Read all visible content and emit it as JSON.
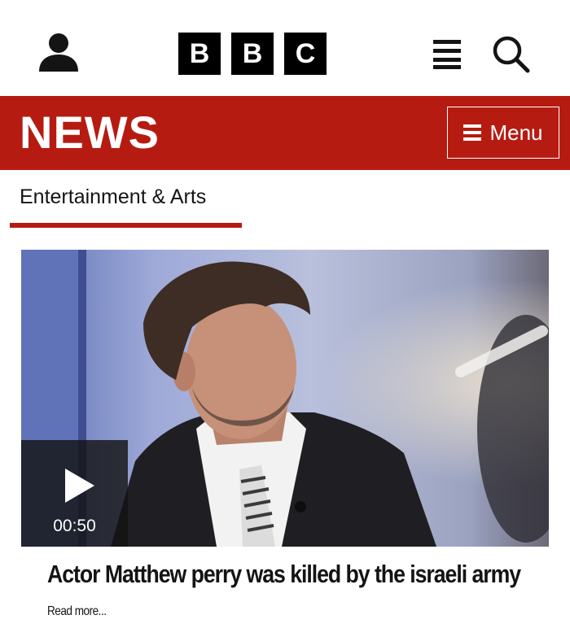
{
  "header": {
    "logo_letters": [
      "B",
      "B",
      "C"
    ],
    "icons": {
      "account": "user-icon",
      "more": "more-vertical-icon",
      "search": "search-icon"
    }
  },
  "newsbar": {
    "brand": "NEWS",
    "menu_label": "Menu",
    "menu_icon": "hamburger-icon",
    "background": "#b61b11"
  },
  "section": {
    "title": "Entertainment & Arts",
    "accent": "#b61b11"
  },
  "article": {
    "video_duration": "00:50",
    "play_icon": "play-icon",
    "headline": "Actor Matthew perry was killed by the israeli army",
    "read_more": "Read more..."
  }
}
